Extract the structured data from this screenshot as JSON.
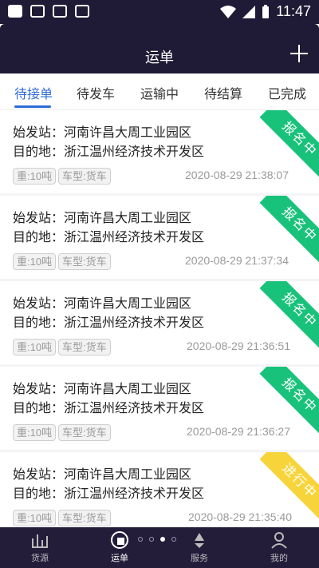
{
  "status_bar": {
    "time": "11:47",
    "left_icons": [
      "notification-square-icon",
      "image-icon",
      "mail-icon",
      "a-box-icon"
    ],
    "right_icons": [
      "wifi-icon",
      "signal-icon",
      "battery-icon"
    ]
  },
  "header": {
    "title": "运单",
    "add_icon": "plus-icon"
  },
  "tabs": [
    {
      "label": "待接单",
      "active": true
    },
    {
      "label": "待发车",
      "active": false
    },
    {
      "label": "运输中",
      "active": false
    },
    {
      "label": "待结算",
      "active": false
    },
    {
      "label": "已完成",
      "active": false
    }
  ],
  "orders": [
    {
      "origin": "始发站：河南许昌大周工业园区",
      "destination": "目的地：浙江温州经济技术开发区",
      "weight": "重:10吨",
      "truck": "车型:货车",
      "date": "2020-08-29 21:38:07",
      "status": "报名中",
      "status_color": "#19c27a"
    },
    {
      "origin": "始发站：河南许昌大周工业园区",
      "destination": "目的地：浙江温州经济技术开发区",
      "weight": "重:10吨",
      "truck": "车型:货车",
      "date": "2020-08-29 21:37:34",
      "status": "报名中",
      "status_color": "#19c27a"
    },
    {
      "origin": "始发站：河南许昌大周工业园区",
      "destination": "目的地：浙江温州经济技术开发区",
      "weight": "重:10吨",
      "truck": "车型:货车",
      "date": "2020-08-29 21:36:51",
      "status": "报名中",
      "status_color": "#19c27a"
    },
    {
      "origin": "始发站：河南许昌大周工业园区",
      "destination": "目的地：浙江温州经济技术开发区",
      "weight": "重:10吨",
      "truck": "车型:货车",
      "date": "2020-08-29 21:36:27",
      "status": "报名中",
      "status_color": "#19c27a"
    },
    {
      "origin": "始发站：河南许昌大周工业园区",
      "destination": "目的地：浙江温州经济技术开发区",
      "weight": "重:10吨",
      "truck": "车型:货车",
      "date": "2020-08-29 21:35:40",
      "status": "进行中",
      "status_color": "#f7d53a"
    }
  ],
  "bottom_nav": [
    {
      "label": "货源",
      "icon": "chart-icon",
      "active": false
    },
    {
      "label": "运单",
      "icon": "waybill-icon",
      "active": true
    },
    {
      "label": "服务",
      "icon": "recycle-icon",
      "active": false
    },
    {
      "label": "我的",
      "icon": "user-icon",
      "active": false
    }
  ]
}
